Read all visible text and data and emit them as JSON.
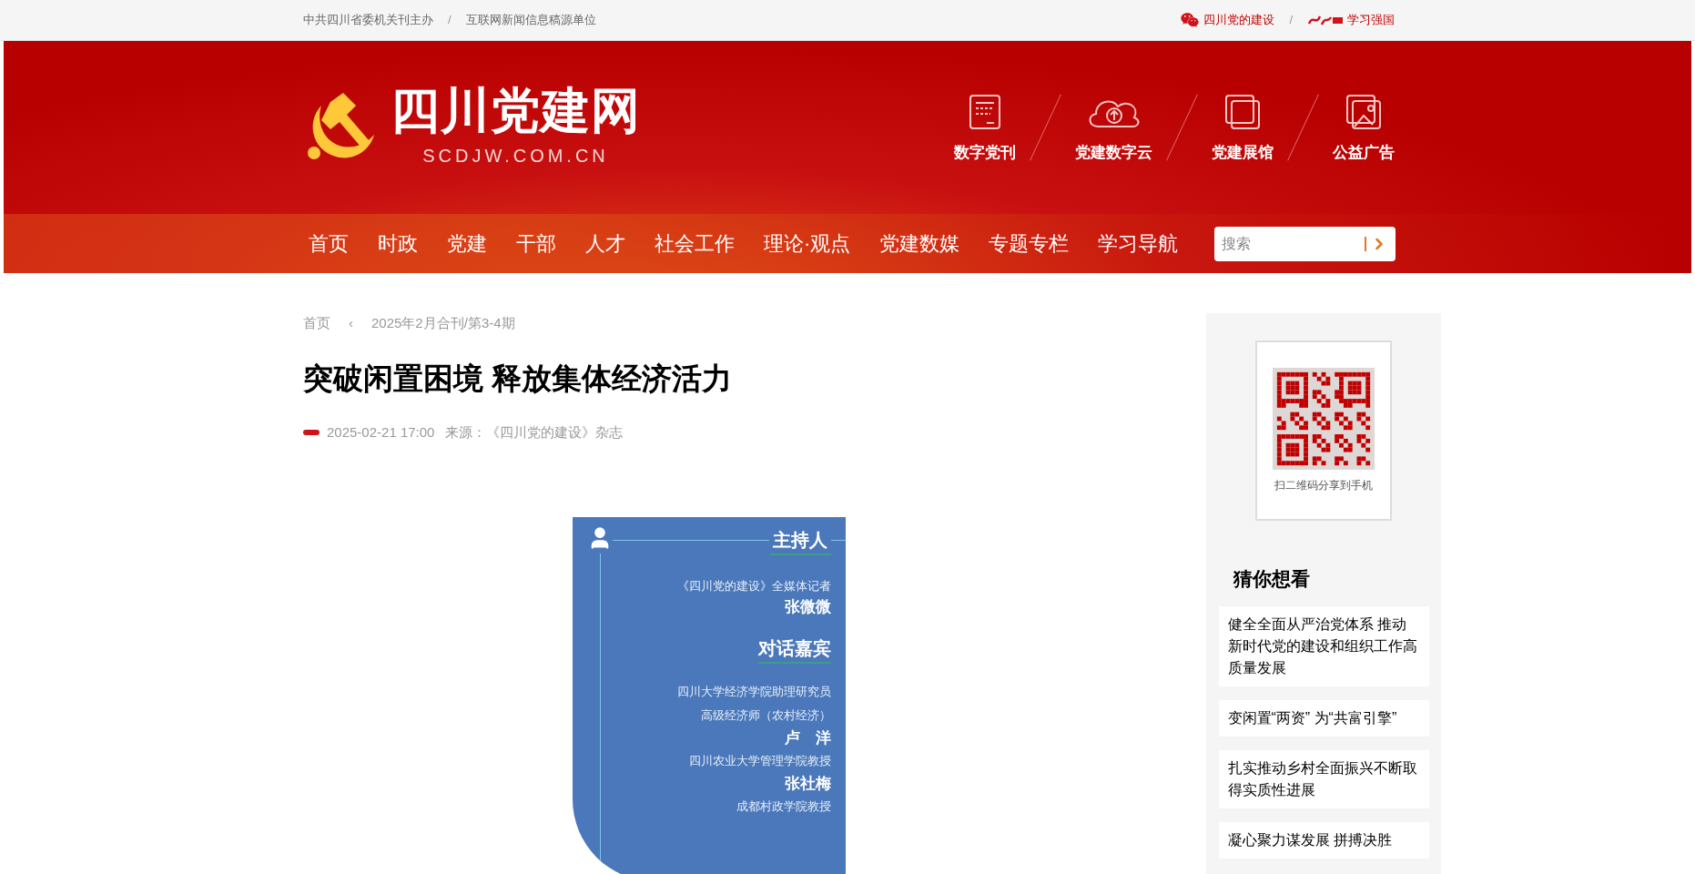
{
  "top_bar": {
    "separator": "/",
    "left_links": [
      "中共四川省委机关刊主办",
      "互联网新闻信息稿源单位"
    ],
    "right_links": [
      {
        "label": "四川党的建设",
        "kind": "wechat"
      },
      {
        "label": "学习强国",
        "kind": "xuexi"
      }
    ]
  },
  "header": {
    "logo_title": "四川党建网",
    "logo_subtitle": "SCDJW.COM.CN",
    "shortcuts": [
      {
        "label": "数字党刊",
        "kind": "journal"
      },
      {
        "label": "党建数字云",
        "kind": "cloud"
      },
      {
        "label": "党建展馆",
        "kind": "vr"
      },
      {
        "label": "公益广告",
        "kind": "picture"
      }
    ]
  },
  "nav": {
    "items": [
      "首页",
      "时政",
      "党建",
      "干部",
      "人才",
      "社会工作",
      "理论·观点",
      "党建数媒",
      "专题专栏",
      "学习导航"
    ],
    "search": {
      "placeholder": "搜索"
    }
  },
  "breadcrumb": {
    "items": [
      "首页",
      "2025年2月合刊/第3-4期"
    ],
    "separator": "‹"
  },
  "article": {
    "title": "突破闲置困境 释放集体经济活力",
    "date": "2025-02-21 17:00",
    "source": "来源：《四川党的建设》杂志"
  },
  "infographic": {
    "host_heading": "主持人",
    "host_role": "《四川党的建设》全媒体记者",
    "host_name": "张微微",
    "guests_heading": "对话嘉宾",
    "guests": [
      {
        "roles": [
          "四川大学经济学院助理研究员",
          "高级经济师（农村经济）"
        ],
        "name": "卢　洋"
      },
      {
        "roles": [
          "四川农业大学管理学院教授"
        ],
        "name": "张社梅"
      },
      {
        "roles": [
          "成都村政学院教授"
        ]
      }
    ]
  },
  "sidebar": {
    "qr_caption": "扫二维码分享到手机",
    "related_heading": "猜你想看",
    "related": [
      "健全全面从严治党体系 推动新时代党的建设和组织工作高质量发展",
      "变闲置“两资” 为“共富引擎”",
      "扎实推动乡村全面振兴不断取得实质性进展",
      "凝心聚力谋发展 拼搏决胜"
    ]
  }
}
